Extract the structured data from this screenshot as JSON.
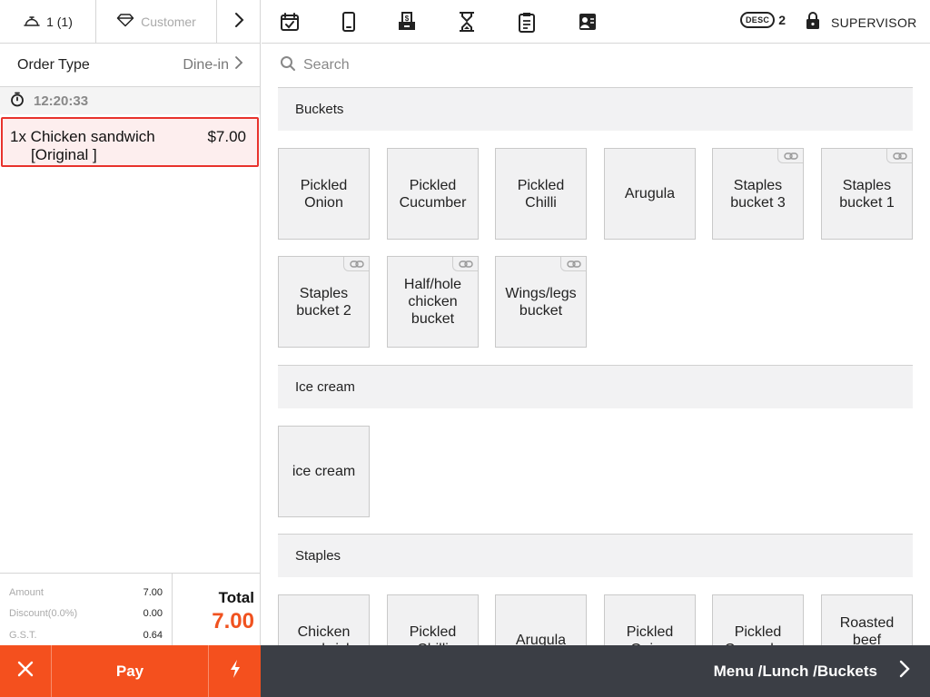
{
  "left_header": {
    "guests_label": "1 (1)",
    "customer_placeholder": "Customer"
  },
  "order_type": {
    "label": "Order Type",
    "value": "Dine-in"
  },
  "timer": "12:20:33",
  "order_items": [
    {
      "qty_name": "1x Chicken sandwich",
      "modifier": "[Original ]",
      "price": "$7.00"
    }
  ],
  "totals": {
    "rows": [
      {
        "label": "Amount",
        "value": "7.00"
      },
      {
        "label": "Discount(0.0%)",
        "value": "0.00"
      },
      {
        "label": "G.S.T.",
        "value": "0.64"
      }
    ],
    "total_label": "Total",
    "total_value": "7.00"
  },
  "actions": {
    "pay_label": "Pay"
  },
  "toolbar": {
    "icons": [
      "calendar-check-icon",
      "tablet-icon",
      "cash-drawer-icon",
      "hourglass-icon",
      "clipboard-icon",
      "staff-card-icon"
    ],
    "desc_badge": "DESC",
    "desc_count": "2",
    "user_role": "SUPERVISOR"
  },
  "search": {
    "placeholder": "Search"
  },
  "categories": [
    {
      "name": "Buckets",
      "items": [
        {
          "label": "Pickled\nOnion",
          "linked": false
        },
        {
          "label": "Pickled\nCucumber",
          "linked": false
        },
        {
          "label": "Pickled\nChilli",
          "linked": false
        },
        {
          "label": "Arugula",
          "linked": false
        },
        {
          "label": "Staples\nbucket  3",
          "linked": true
        },
        {
          "label": "Staples\nbucket  1",
          "linked": true
        },
        {
          "label": "Staples\nbucket  2",
          "linked": true
        },
        {
          "label": "Half/hole\nchicken\nbucket",
          "linked": true
        },
        {
          "label": "Wings/legs\nbucket",
          "linked": true
        }
      ]
    },
    {
      "name": "Ice cream",
      "items": [
        {
          "label": "ice  cream",
          "linked": false
        }
      ]
    },
    {
      "name": "Staples",
      "items": [
        {
          "label": "Chicken\nsandwich",
          "linked": false
        },
        {
          "label": "Pickled\nChilli",
          "linked": false
        },
        {
          "label": "Arugula",
          "linked": false
        },
        {
          "label": "Pickled\nOnion",
          "linked": false
        },
        {
          "label": "Pickled\nCucumber",
          "linked": false
        },
        {
          "label": "Roasted\nbeef\nsandwich",
          "linked": false
        }
      ]
    }
  ],
  "breadcrumb": "Menu /Lunch /Buckets",
  "colors": {
    "accent": "#f4501e",
    "total": "#f0521f",
    "selected_border": "#e8322c",
    "selected_bg": "#fdeeee",
    "footer_dark": "#3b3e45"
  }
}
